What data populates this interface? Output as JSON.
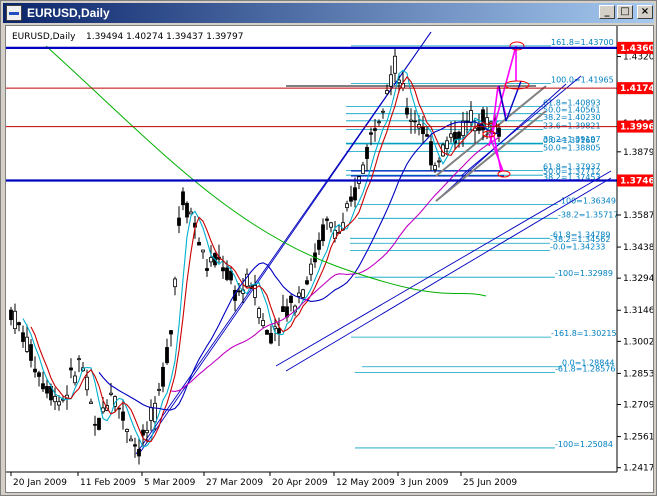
{
  "window": {
    "title": "EURUSD,Daily",
    "minimize_glyph": "_",
    "maximize_glyph": "□",
    "close_glyph": "×"
  },
  "chart_info": {
    "symbol": "EURUSD,Daily",
    "ohlc": "1.39494 1.40274 1.39437 1.39797"
  },
  "colors": {
    "background": "#ffffff",
    "candle": "#000000",
    "ma_fast": "#00b0d0",
    "ma_red": "#cc0000",
    "ma_blue": "#0000c0",
    "ma_magenta": "#c000c0",
    "ma_green": "#00b000",
    "fib_line": "#00a0c0",
    "fib_text": "#0080c0",
    "hline_blue": "#0000c0",
    "hline_red": "#c00000",
    "price_red_tag": "#ff0000",
    "arrow": "#ff00ff"
  },
  "chart_data": {
    "type": "candlestick",
    "x_ticks": [
      "20 Jan 2009",
      "11 Feb 2009",
      "5 Mar 2009",
      "27 Mar 2009",
      "20 Apr 2009",
      "12 May 2009",
      "3 Jun 2009",
      "25 Jun 2009"
    ],
    "y_ticks": [
      "1.43205",
      "1.40120",
      "1.38795",
      "1.35870",
      "1.34385",
      "1.32945",
      "1.31460",
      "1.30020",
      "1.28535",
      "1.27095",
      "1.25610",
      "1.24170"
    ],
    "ylim": [
      1.2397,
      1.4425
    ],
    "price_tags": [
      {
        "label": "1.43608",
        "value": 1.43608,
        "color": "#ff0000"
      },
      {
        "label": "1.41743",
        "value": 1.41743,
        "color": "#ff0000"
      },
      {
        "label": "1.39964",
        "value": 1.39964,
        "color": "#ff0000"
      },
      {
        "label": "1.37467",
        "value": 1.37467,
        "color": "#ff0000"
      }
    ],
    "fib_labels": [
      {
        "text": "161.8=1.43700",
        "value": 1.437,
        "x": 545
      },
      {
        "text": "100.0=1.41965",
        "value": 1.41965,
        "x": 545
      },
      {
        "text": "61.8=1.40893",
        "value": 1.40893,
        "x": 537
      },
      {
        "text": "50.0=1.40561",
        "value": 1.40561,
        "x": 537
      },
      {
        "text": "38.2=1.40230",
        "value": 1.4023,
        "x": 537
      },
      {
        "text": "23.6=1.39821",
        "value": 1.39821,
        "x": 537
      },
      {
        "text": "0.0=1.39160",
        "value": 1.3916,
        "x": 537
      },
      {
        "text": "38.2=1.39197",
        "value": 1.39197,
        "x": 537
      },
      {
        "text": "50.0=1.38805",
        "value": 1.38805,
        "x": 537
      },
      {
        "text": "61.8=1.37937",
        "value": 1.37937,
        "x": 537
      },
      {
        "text": "50.0=1.37712",
        "value": 1.37712,
        "x": 537
      },
      {
        "text": "38.2=1.37453",
        "value": 1.37453,
        "x": 537
      },
      {
        "text": "-100=1.36349",
        "value": 1.36349,
        "x": 552
      },
      {
        "text": "-38.2=1.35717",
        "value": 1.35717,
        "x": 552
      },
      {
        "text": "-61.8=1.34789",
        "value": 1.34789,
        "x": 544
      },
      {
        "text": "-38.2=1.34562",
        "value": 1.34562,
        "x": 544
      },
      {
        "text": "-0.0=1.34233",
        "value": 1.34233,
        "x": 544
      },
      {
        "text": "-100=1.32989",
        "value": 1.32989,
        "x": 549
      },
      {
        "text": "-161.8=1.30215",
        "value": 1.30215,
        "x": 545
      },
      {
        "text": "0.0=1.28844",
        "value": 1.28844,
        "x": 556
      },
      {
        "text": "-61.8=1.28576",
        "value": 1.28576,
        "x": 549
      },
      {
        "text": "-100=1.25084",
        "value": 1.25084,
        "x": 549
      }
    ]
  }
}
